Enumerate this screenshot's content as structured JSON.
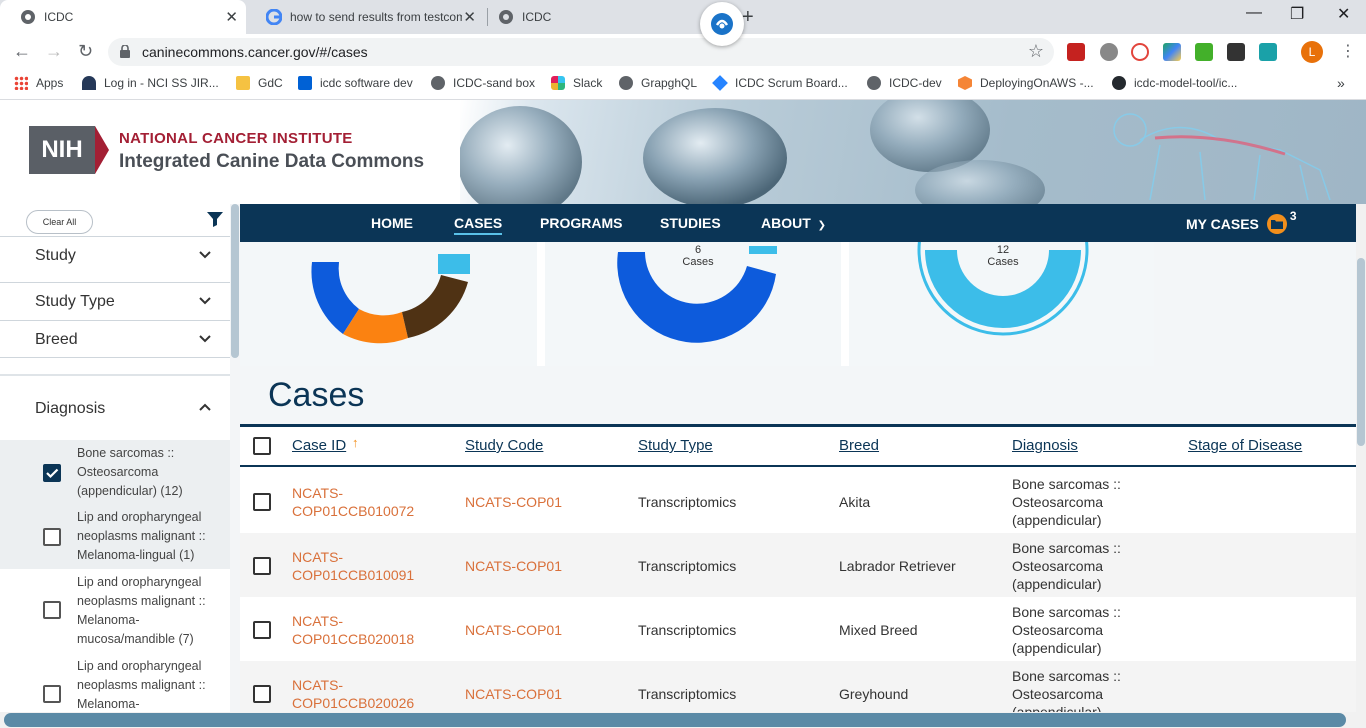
{
  "browser": {
    "tabs": [
      {
        "title": "ICDC",
        "active": true
      },
      {
        "title": "how to send results from testcom",
        "active": false
      },
      {
        "title": "ICDC",
        "active": false
      }
    ],
    "url": "caninecommons.cancer.gov/#/cases",
    "profile_initial": "L",
    "bookmarks": [
      {
        "label": "Apps",
        "icon": "apps-grid-icon"
      },
      {
        "label": "Log in - NCI SS JIR...",
        "icon": "jira-icon"
      },
      {
        "label": "GdC",
        "icon": "folder-icon"
      },
      {
        "label": "icdc software dev",
        "icon": "box-icon"
      },
      {
        "label": "ICDC-sand box",
        "icon": "globe-icon"
      },
      {
        "label": "Slack",
        "icon": "slack-icon"
      },
      {
        "label": "GrapghQL",
        "icon": "globe-icon"
      },
      {
        "label": "ICDC Scrum Board...",
        "icon": "jira-diamond-icon"
      },
      {
        "label": "ICDC-dev",
        "icon": "globe-icon"
      },
      {
        "label": "DeployingOnAWS -...",
        "icon": "aws-icon"
      },
      {
        "label": "icdc-model-tool/ic...",
        "icon": "github-icon"
      }
    ]
  },
  "header": {
    "logo_text": "NIH",
    "institute": "NATIONAL CANCER INSTITUTE",
    "portal": "Integrated Canine Data Commons"
  },
  "nav": {
    "items": [
      "HOME",
      "CASES",
      "PROGRAMS",
      "STUDIES",
      "ABOUT"
    ],
    "active": "CASES",
    "my_cases_label": "MY CASES",
    "my_cases_count": "3"
  },
  "sidebar": {
    "clear_all": "Clear All",
    "facets": [
      "Study",
      "Study Type",
      "Breed"
    ],
    "diagnosis_label": "Diagnosis",
    "diagnosis_options": [
      {
        "label": "Bone sarcomas :: Osteosarcoma (appendicular) (12)",
        "checked": true
      },
      {
        "label": "Lip and oropharyngeal neoplasms malignant :: Melanoma-lingual (1)",
        "checked": false
      },
      {
        "label": "Lip and oropharyngeal neoplasms malignant :: Melanoma-mucosa/mandible (7)",
        "checked": false
      },
      {
        "label": "Lip and oropharyngeal neoplasms malignant :: Melanoma-",
        "checked": false
      }
    ]
  },
  "donuts": [
    {
      "count": "",
      "unit": ""
    },
    {
      "count": "6",
      "unit": "Cases"
    },
    {
      "count": "12",
      "unit": "Cases"
    }
  ],
  "cases": {
    "title": "Cases",
    "columns": [
      "Case ID",
      "Study Code",
      "Study Type",
      "Breed",
      "Diagnosis",
      "Stage of Disease"
    ],
    "sort_column": "Case ID",
    "rows": [
      {
        "case_id": "NCATS-COP01CCB010072",
        "case_id_l1": "NCATS-",
        "case_id_l2": "COP01CCB010072",
        "study_code": "NCATS-COP01",
        "study_type": "Transcriptomics",
        "breed": "Akita",
        "diag_l1": "Bone sarcomas ::",
        "diag_l2": "Osteosarcoma",
        "diag_l3": "(appendicular)",
        "stage": ""
      },
      {
        "case_id": "NCATS-COP01CCB010091",
        "case_id_l1": "NCATS-",
        "case_id_l2": "COP01CCB010091",
        "study_code": "NCATS-COP01",
        "study_type": "Transcriptomics",
        "breed": "Labrador Retriever",
        "diag_l1": "Bone sarcomas ::",
        "diag_l2": "Osteosarcoma",
        "diag_l3": "(appendicular)",
        "stage": ""
      },
      {
        "case_id": "NCATS-COP01CCB020018",
        "case_id_l1": "NCATS-",
        "case_id_l2": "COP01CCB020018",
        "study_code": "NCATS-COP01",
        "study_type": "Transcriptomics",
        "breed": "Mixed Breed",
        "diag_l1": "Bone sarcomas ::",
        "diag_l2": "Osteosarcoma",
        "diag_l3": "(appendicular)",
        "stage": ""
      },
      {
        "case_id": "NCATS-COP01CCB020026",
        "case_id_l1": "NCATS-",
        "case_id_l2": "COP01CCB020026",
        "study_code": "NCATS-COP01",
        "study_type": "Transcriptomics",
        "breed": "Greyhound",
        "diag_l1": "Bone sarcomas ::",
        "diag_l2": "Osteosarcoma",
        "diag_l3": "(appendicular)",
        "stage": ""
      }
    ]
  },
  "colors": {
    "navy": "#0b3556",
    "link_orange": "#d9703a",
    "nci_red": "#a31f34",
    "donut_blue": "#0d5bdc",
    "donut_light": "#3cbde9",
    "donut_orange": "#fb8211",
    "donut_brown": "#4f3214"
  }
}
